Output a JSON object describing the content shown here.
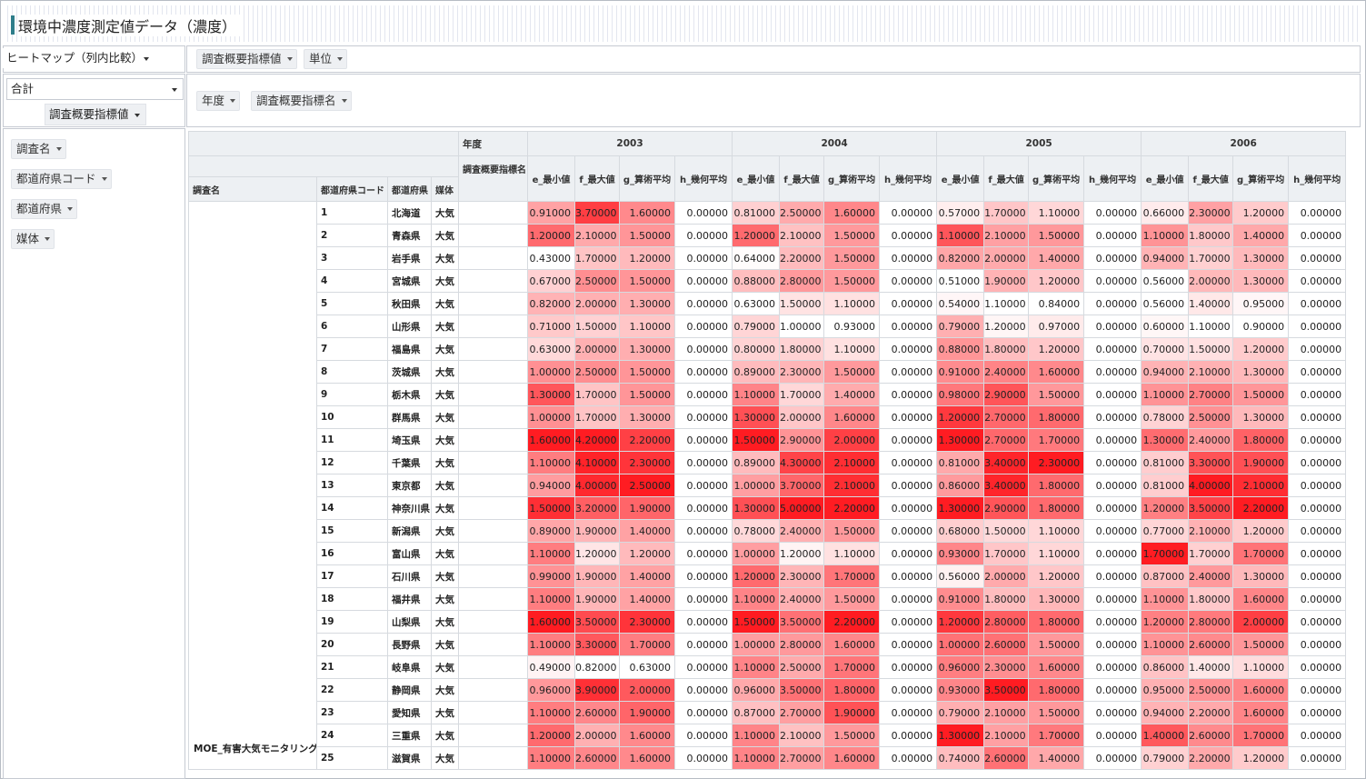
{
  "title": "環境中濃度測定値データ（濃度）",
  "renderer": {
    "label": "ヒートマップ（列内比較）"
  },
  "aggregator": {
    "label": "合計",
    "value_field": "調査概要指標値"
  },
  "col_fields": [
    "調査概要指標値",
    "単位"
  ],
  "row_fields_top": [
    "年度",
    "調査概要指標名"
  ],
  "unused_fields": [
    "調査名",
    "都道府県コード",
    "都道府県",
    "媒体"
  ],
  "header": {
    "year_label": "年度",
    "indicator_label": "調査概要指標名",
    "row_headers": [
      "調査名",
      "都道府県コード",
      "都道府県",
      "媒体"
    ]
  },
  "years": [
    "2003",
    "2004",
    "2005",
    "2006"
  ],
  "indicators": [
    "e_最小値",
    "f_最大値",
    "g_算術平均",
    "h_幾何平均"
  ],
  "survey_name": "MOE_有害大気モニタリング",
  "media": "大気",
  "heat_color": "#ef1c22",
  "rows": [
    {
      "code": "1",
      "pref": "北海道",
      "values": [
        "0.91000",
        "3.70000",
        "1.60000",
        "0.00000",
        "0.81000",
        "2.50000",
        "1.60000",
        "0.00000",
        "0.57000",
        "1.70000",
        "1.10000",
        "0.00000",
        "0.66000",
        "2.30000",
        "1.20000",
        "0.00000"
      ]
    },
    {
      "code": "2",
      "pref": "青森県",
      "values": [
        "1.20000",
        "2.10000",
        "1.50000",
        "0.00000",
        "1.20000",
        "2.10000",
        "1.50000",
        "0.00000",
        "1.10000",
        "2.10000",
        "1.50000",
        "0.00000",
        "1.10000",
        "1.80000",
        "1.40000",
        "0.00000"
      ]
    },
    {
      "code": "3",
      "pref": "岩手県",
      "values": [
        "0.43000",
        "1.70000",
        "1.20000",
        "0.00000",
        "0.64000",
        "2.20000",
        "1.50000",
        "0.00000",
        "0.82000",
        "2.00000",
        "1.40000",
        "0.00000",
        "0.94000",
        "1.70000",
        "1.30000",
        "0.00000"
      ]
    },
    {
      "code": "4",
      "pref": "宮城県",
      "values": [
        "0.67000",
        "2.50000",
        "1.50000",
        "0.00000",
        "0.88000",
        "2.80000",
        "1.50000",
        "0.00000",
        "0.51000",
        "1.90000",
        "1.20000",
        "0.00000",
        "0.56000",
        "2.00000",
        "1.30000",
        "0.00000"
      ]
    },
    {
      "code": "5",
      "pref": "秋田県",
      "values": [
        "0.82000",
        "2.00000",
        "1.30000",
        "0.00000",
        "0.63000",
        "1.50000",
        "1.10000",
        "0.00000",
        "0.54000",
        "1.10000",
        "0.84000",
        "0.00000",
        "0.56000",
        "1.40000",
        "0.95000",
        "0.00000"
      ]
    },
    {
      "code": "6",
      "pref": "山形県",
      "values": [
        "0.71000",
        "1.50000",
        "1.10000",
        "0.00000",
        "0.79000",
        "1.00000",
        "0.93000",
        "0.00000",
        "0.79000",
        "1.20000",
        "0.97000",
        "0.00000",
        "0.60000",
        "1.10000",
        "0.90000",
        "0.00000"
      ]
    },
    {
      "code": "7",
      "pref": "福島県",
      "values": [
        "0.63000",
        "2.00000",
        "1.30000",
        "0.00000",
        "0.80000",
        "1.80000",
        "1.10000",
        "0.00000",
        "0.88000",
        "1.80000",
        "1.20000",
        "0.00000",
        "0.70000",
        "1.50000",
        "1.20000",
        "0.00000"
      ]
    },
    {
      "code": "8",
      "pref": "茨城県",
      "values": [
        "1.00000",
        "2.50000",
        "1.50000",
        "0.00000",
        "0.89000",
        "2.30000",
        "1.50000",
        "0.00000",
        "0.91000",
        "2.40000",
        "1.60000",
        "0.00000",
        "0.94000",
        "2.10000",
        "1.30000",
        "0.00000"
      ]
    },
    {
      "code": "9",
      "pref": "栃木県",
      "values": [
        "1.30000",
        "1.70000",
        "1.50000",
        "0.00000",
        "1.10000",
        "1.70000",
        "1.40000",
        "0.00000",
        "0.98000",
        "2.90000",
        "1.50000",
        "0.00000",
        "1.10000",
        "2.70000",
        "1.50000",
        "0.00000"
      ]
    },
    {
      "code": "10",
      "pref": "群馬県",
      "values": [
        "1.00000",
        "1.70000",
        "1.30000",
        "0.00000",
        "1.30000",
        "2.00000",
        "1.60000",
        "0.00000",
        "1.20000",
        "2.70000",
        "1.80000",
        "0.00000",
        "0.78000",
        "2.50000",
        "1.30000",
        "0.00000"
      ]
    },
    {
      "code": "11",
      "pref": "埼玉県",
      "values": [
        "1.60000",
        "4.20000",
        "2.20000",
        "0.00000",
        "1.50000",
        "2.90000",
        "2.00000",
        "0.00000",
        "1.30000",
        "2.70000",
        "1.70000",
        "0.00000",
        "1.30000",
        "2.40000",
        "1.80000",
        "0.00000"
      ]
    },
    {
      "code": "12",
      "pref": "千葉県",
      "values": [
        "1.10000",
        "4.10000",
        "2.30000",
        "0.00000",
        "0.89000",
        "4.30000",
        "2.10000",
        "0.00000",
        "0.81000",
        "3.40000",
        "2.30000",
        "0.00000",
        "0.81000",
        "3.30000",
        "1.90000",
        "0.00000"
      ]
    },
    {
      "code": "13",
      "pref": "東京都",
      "values": [
        "0.94000",
        "4.00000",
        "2.50000",
        "0.00000",
        "1.00000",
        "3.70000",
        "2.10000",
        "0.00000",
        "0.86000",
        "3.40000",
        "1.80000",
        "0.00000",
        "0.81000",
        "4.00000",
        "2.10000",
        "0.00000"
      ]
    },
    {
      "code": "14",
      "pref": "神奈川県",
      "values": [
        "1.50000",
        "3.20000",
        "1.90000",
        "0.00000",
        "1.30000",
        "5.00000",
        "2.20000",
        "0.00000",
        "1.30000",
        "2.90000",
        "1.80000",
        "0.00000",
        "1.20000",
        "3.50000",
        "2.20000",
        "0.00000"
      ]
    },
    {
      "code": "15",
      "pref": "新潟県",
      "values": [
        "0.89000",
        "1.90000",
        "1.40000",
        "0.00000",
        "0.78000",
        "2.40000",
        "1.50000",
        "0.00000",
        "0.68000",
        "1.50000",
        "1.10000",
        "0.00000",
        "0.77000",
        "2.10000",
        "1.20000",
        "0.00000"
      ]
    },
    {
      "code": "16",
      "pref": "富山県",
      "values": [
        "1.10000",
        "1.20000",
        "1.20000",
        "0.00000",
        "1.00000",
        "1.20000",
        "1.10000",
        "0.00000",
        "0.93000",
        "1.70000",
        "1.10000",
        "0.00000",
        "1.70000",
        "1.70000",
        "1.70000",
        "0.00000"
      ]
    },
    {
      "code": "17",
      "pref": "石川県",
      "values": [
        "0.99000",
        "1.90000",
        "1.40000",
        "0.00000",
        "1.20000",
        "2.30000",
        "1.70000",
        "0.00000",
        "0.56000",
        "2.00000",
        "1.20000",
        "0.00000",
        "0.87000",
        "2.40000",
        "1.30000",
        "0.00000"
      ]
    },
    {
      "code": "18",
      "pref": "福井県",
      "values": [
        "1.10000",
        "1.90000",
        "1.40000",
        "0.00000",
        "1.10000",
        "2.40000",
        "1.50000",
        "0.00000",
        "0.91000",
        "1.80000",
        "1.30000",
        "0.00000",
        "1.10000",
        "1.80000",
        "1.60000",
        "0.00000"
      ]
    },
    {
      "code": "19",
      "pref": "山梨県",
      "values": [
        "1.60000",
        "3.50000",
        "2.30000",
        "0.00000",
        "1.50000",
        "3.50000",
        "2.20000",
        "0.00000",
        "1.20000",
        "2.80000",
        "1.80000",
        "0.00000",
        "1.20000",
        "2.80000",
        "2.00000",
        "0.00000"
      ]
    },
    {
      "code": "20",
      "pref": "長野県",
      "values": [
        "1.10000",
        "3.30000",
        "1.70000",
        "0.00000",
        "1.00000",
        "2.80000",
        "1.60000",
        "0.00000",
        "1.00000",
        "2.60000",
        "1.50000",
        "0.00000",
        "1.10000",
        "2.60000",
        "1.50000",
        "0.00000"
      ]
    },
    {
      "code": "21",
      "pref": "岐阜県",
      "values": [
        "0.49000",
        "0.82000",
        "0.63000",
        "0.00000",
        "1.10000",
        "2.50000",
        "1.70000",
        "0.00000",
        "0.96000",
        "2.30000",
        "1.60000",
        "0.00000",
        "0.86000",
        "1.40000",
        "1.10000",
        "0.00000"
      ]
    },
    {
      "code": "22",
      "pref": "静岡県",
      "values": [
        "0.96000",
        "3.90000",
        "2.00000",
        "0.00000",
        "0.96000",
        "3.50000",
        "1.80000",
        "0.00000",
        "0.93000",
        "3.50000",
        "1.80000",
        "0.00000",
        "0.95000",
        "2.50000",
        "1.60000",
        "0.00000"
      ]
    },
    {
      "code": "23",
      "pref": "愛知県",
      "values": [
        "1.10000",
        "2.60000",
        "1.90000",
        "0.00000",
        "0.87000",
        "2.70000",
        "1.90000",
        "0.00000",
        "0.79000",
        "2.10000",
        "1.50000",
        "0.00000",
        "0.94000",
        "2.20000",
        "1.60000",
        "0.00000"
      ]
    },
    {
      "code": "24",
      "pref": "三重県",
      "values": [
        "1.20000",
        "2.00000",
        "1.60000",
        "0.00000",
        "1.10000",
        "2.10000",
        "1.50000",
        "0.00000",
        "1.30000",
        "2.10000",
        "1.70000",
        "0.00000",
        "1.40000",
        "2.60000",
        "1.70000",
        "0.00000"
      ]
    },
    {
      "code": "25",
      "pref": "滋賀県",
      "values": [
        "1.10000",
        "2.60000",
        "1.60000",
        "0.00000",
        "1.10000",
        "2.70000",
        "1.60000",
        "0.00000",
        "0.74000",
        "2.60000",
        "1.40000",
        "0.00000",
        "0.79000",
        "2.20000",
        "1.20000",
        "0.00000"
      ]
    }
  ]
}
